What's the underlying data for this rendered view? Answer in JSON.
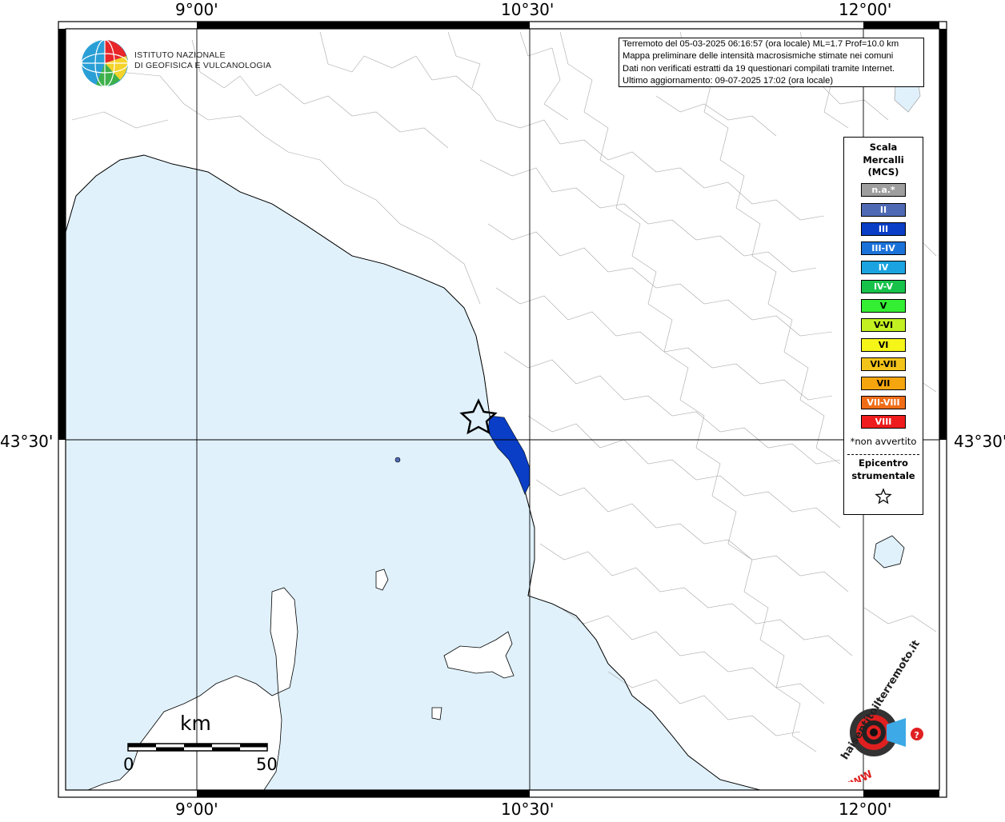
{
  "map": {
    "coords": {
      "lon_top": [
        "9°00'",
        "10°30'",
        "12°00'"
      ],
      "lon_bottom": [
        "9°00'",
        "10°30'",
        "12°00'"
      ],
      "lat_left": "43°30'",
      "lat_right": "43°30'"
    },
    "colors": {
      "sea": "#e0f1fb",
      "land": "#ffffff",
      "boundary": "#a9a9a9",
      "intensity_iii": "#0033cc"
    }
  },
  "institute": {
    "line1": "ISTITUTO NAZIONALE",
    "line2": "DI GEOFISICA E VULCANOLOGIA"
  },
  "info": {
    "line1": "Terremoto del 05-03-2025 06:16:57 (ora locale) ML=1.7 Prof=10.0 km",
    "line2": "Mappa preliminare delle intensità macrosismiche stimate nei comuni",
    "line3": "Dati non verificati estratti da 19 questionari compilati tramite Internet.",
    "line4": "Ultimo aggiornamento: 09-07-2025 17:02 (ora locale)"
  },
  "legend": {
    "title1": "Scala",
    "title2": "Mercalli",
    "title3": "(MCS)",
    "items": [
      {
        "label": "n.a.*",
        "color": "#9e9e9e"
      },
      {
        "label": "II",
        "color": "#4f6ab5"
      },
      {
        "label": "III",
        "color": "#0a3ec6"
      },
      {
        "label": "III-IV",
        "color": "#1a72d8"
      },
      {
        "label": "IV",
        "color": "#1aa3e0"
      },
      {
        "label": "IV-V",
        "color": "#17c24a"
      },
      {
        "label": "V",
        "color": "#33ee33"
      },
      {
        "label": "V-VI",
        "color": "#c3f020"
      },
      {
        "label": "VI",
        "color": "#f5f518"
      },
      {
        "label": "VI-VII",
        "color": "#f2c31a"
      },
      {
        "label": "VII",
        "color": "#f5a50e"
      },
      {
        "label": "VII-VIII",
        "color": "#f06d18"
      },
      {
        "label": "VIII",
        "color": "#ee1c1c"
      }
    ],
    "note": "*non avvertito",
    "epicentre1": "Epicentro",
    "epicentre2": "strumentale"
  },
  "scale": {
    "unit": "km",
    "start": "0",
    "end": "50"
  },
  "badge": {
    "text": "haisentitoilterremoto.it",
    "www": "WWW"
  }
}
